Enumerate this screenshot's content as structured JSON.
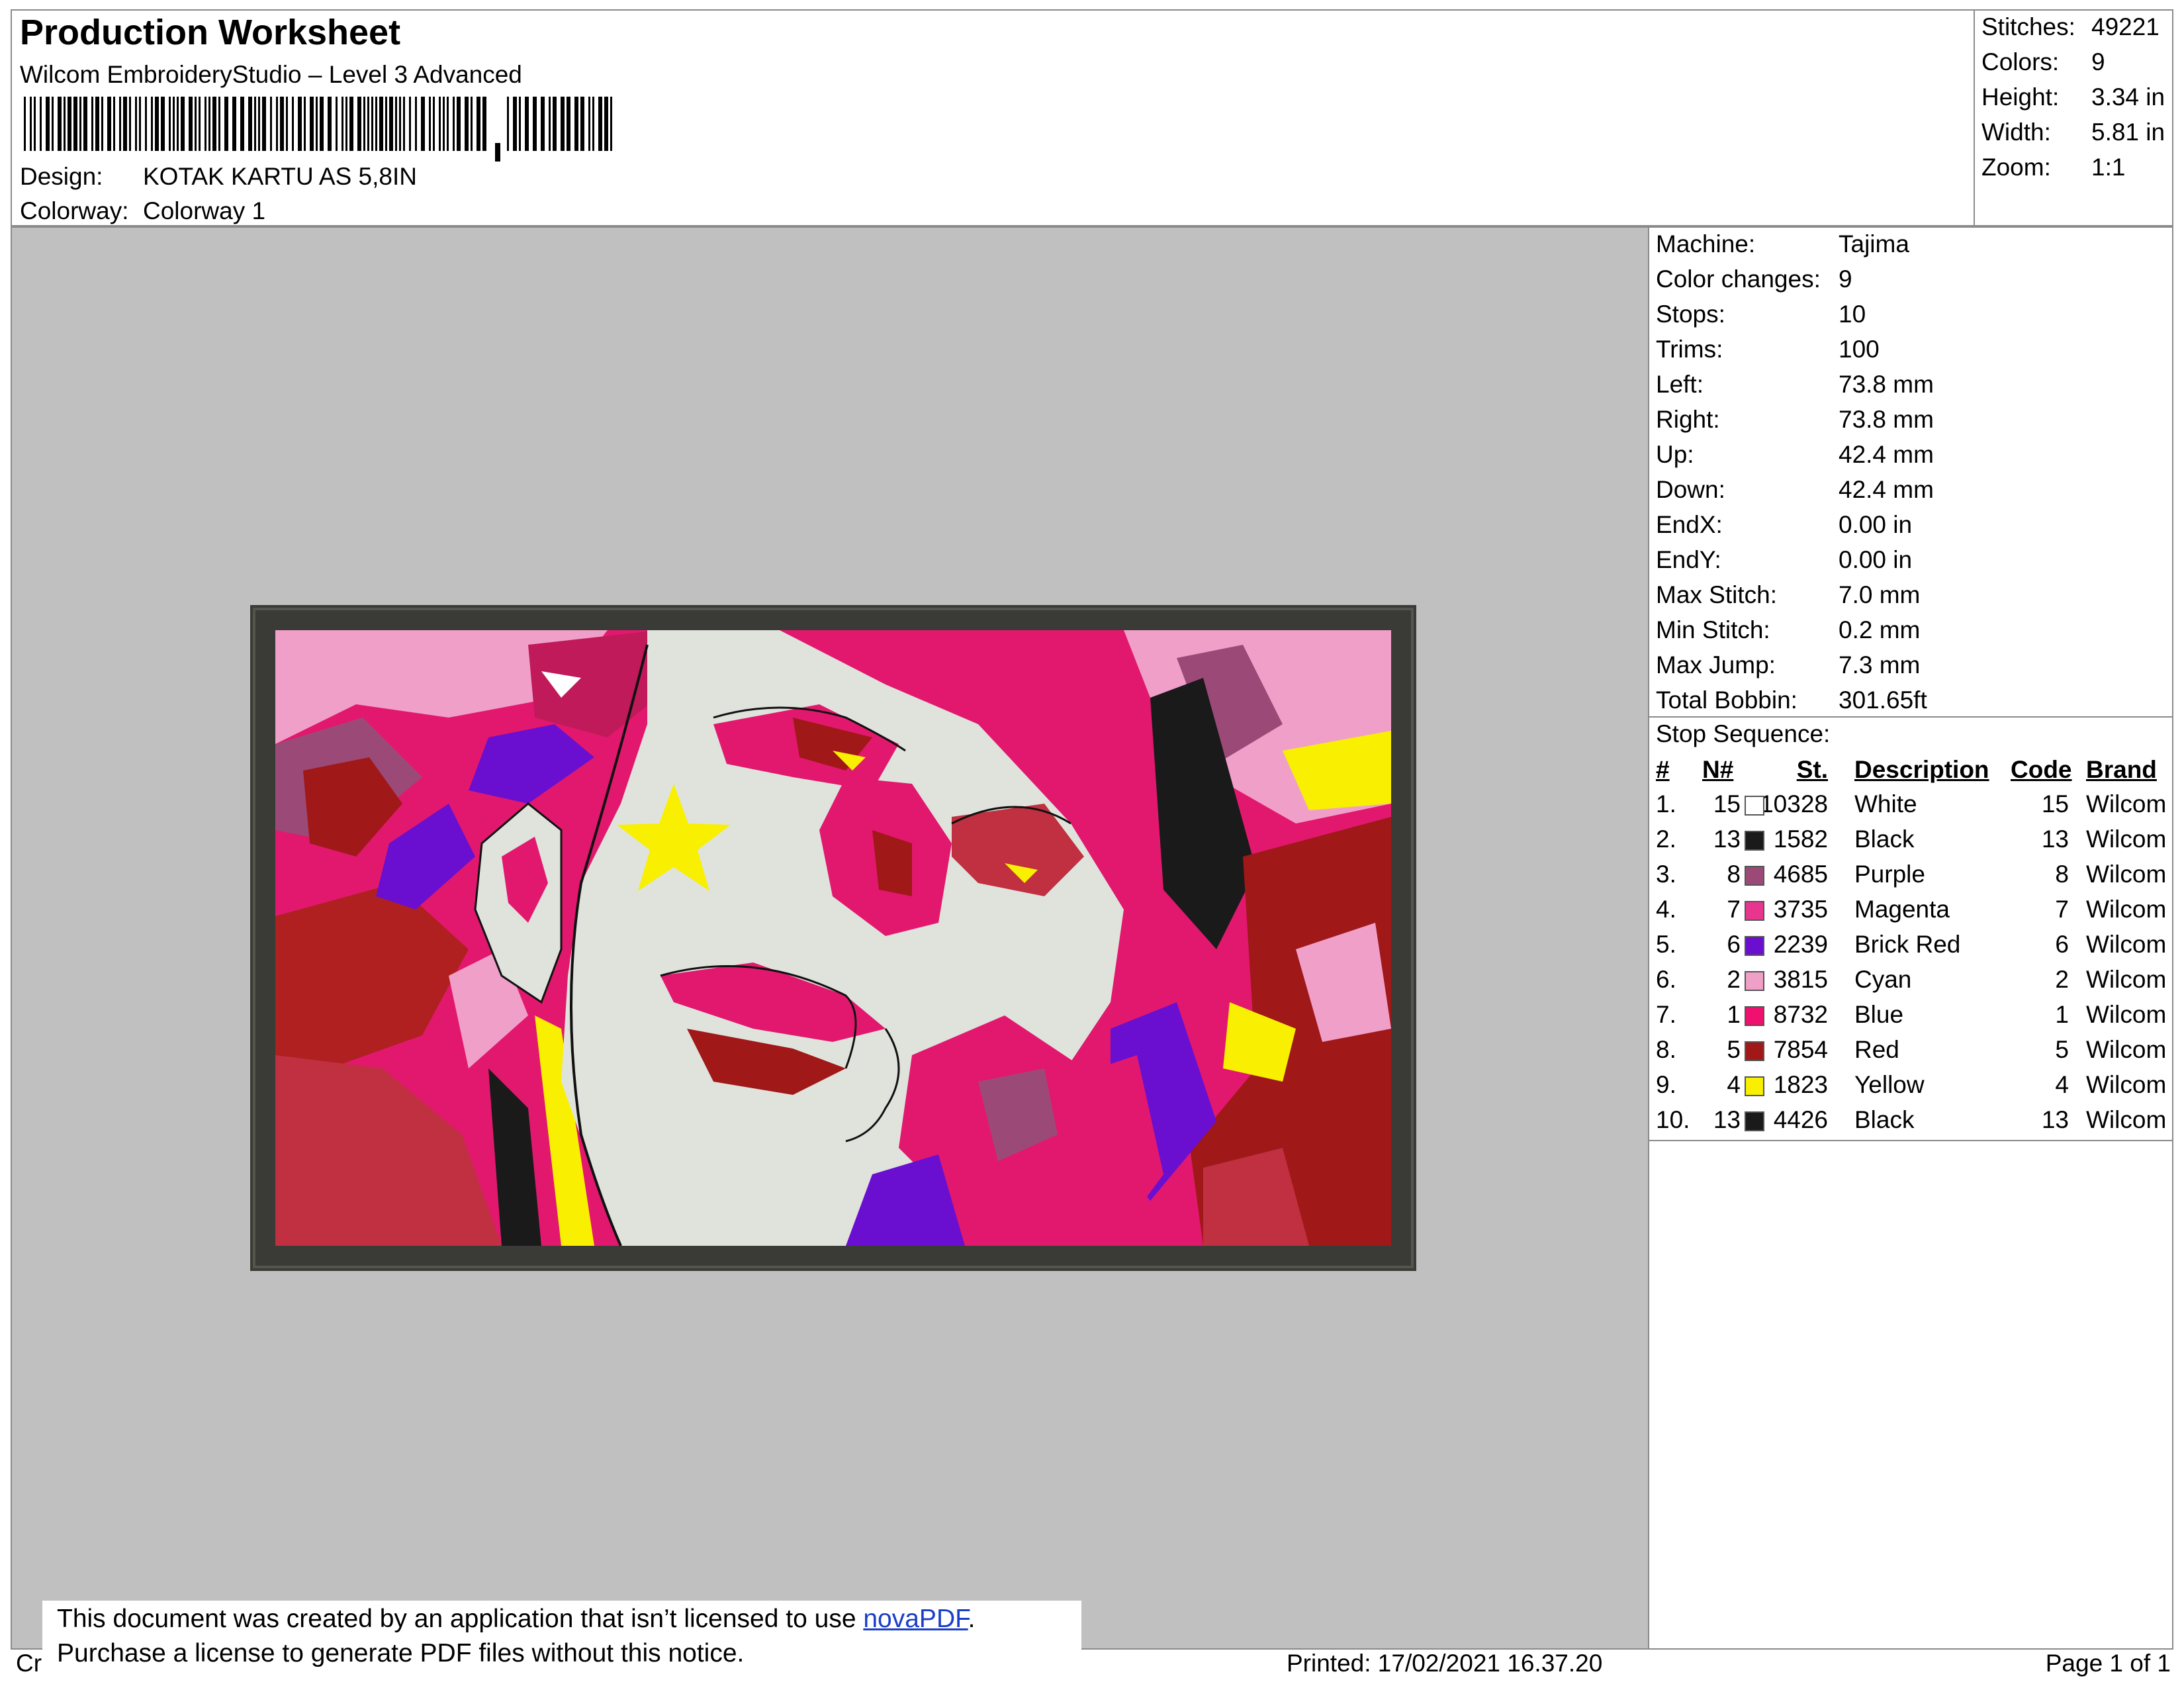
{
  "header": {
    "title": "Production Worksheet",
    "app_name": "Wilcom EmbroideryStudio – Level 3 Advanced",
    "design_label": "Design:",
    "design_value": "KOTAK KARTU AS 5,8IN",
    "colorway_label": "Colorway:",
    "colorway_value": "Colorway 1"
  },
  "stats": [
    {
      "label": "Stitches:",
      "value": "49221"
    },
    {
      "label": "Colors:",
      "value": "9"
    },
    {
      "label": "Height:",
      "value": "3.34 in"
    },
    {
      "label": "Width:",
      "value": "5.81 in"
    },
    {
      "label": "Zoom:",
      "value": "1:1"
    }
  ],
  "machine_info": [
    {
      "label": "Machine:",
      "value": "Tajima"
    },
    {
      "label": "Color changes:",
      "value": "9"
    },
    {
      "label": "Stops:",
      "value": "10"
    },
    {
      "label": "Trims:",
      "value": "100"
    },
    {
      "label": "Left:",
      "value": "73.8 mm"
    },
    {
      "label": "Right:",
      "value": "73.8 mm"
    },
    {
      "label": "Up:",
      "value": "42.4 mm"
    },
    {
      "label": "Down:",
      "value": "42.4 mm"
    },
    {
      "label": "EndX:",
      "value": "0.00 in"
    },
    {
      "label": "EndY:",
      "value": "0.00 in"
    },
    {
      "label": "Max Stitch:",
      "value": "7.0 mm"
    },
    {
      "label": "Min Stitch:",
      "value": "0.2 mm"
    },
    {
      "label": "Max Jump:",
      "value": "7.3 mm"
    },
    {
      "label": "Total Bobbin:",
      "value": "301.65ft"
    }
  ],
  "stop_sequence": {
    "title": "Stop Sequence:",
    "headers": {
      "num": "#",
      "n": "N#",
      "st": "St.",
      "description": "Description",
      "code": "Code",
      "brand": "Brand"
    },
    "rows": [
      {
        "num": "1.",
        "n": "15",
        "color": "#ffffff",
        "st": "10328",
        "description": "White",
        "code": "15",
        "brand": "Wilcom"
      },
      {
        "num": "2.",
        "n": "13",
        "color": "#1a1a1a",
        "st": "1582",
        "description": "Black",
        "code": "13",
        "brand": "Wilcom"
      },
      {
        "num": "3.",
        "n": "8",
        "color": "#9b4a78",
        "st": "4685",
        "description": "Purple",
        "code": "8",
        "brand": "Wilcom"
      },
      {
        "num": "4.",
        "n": "7",
        "color": "#e8368f",
        "st": "3735",
        "description": "Magenta",
        "code": "7",
        "brand": "Wilcom"
      },
      {
        "num": "5.",
        "n": "6",
        "color": "#6a0fd0",
        "st": "2239",
        "description": "Brick Red",
        "code": "6",
        "brand": "Wilcom"
      },
      {
        "num": "6.",
        "n": "2",
        "color": "#f0a0c8",
        "st": "3815",
        "description": "Cyan",
        "code": "2",
        "brand": "Wilcom"
      },
      {
        "num": "7.",
        "n": "1",
        "color": "#f01070",
        "st": "8732",
        "description": "Blue",
        "code": "1",
        "brand": "Wilcom"
      },
      {
        "num": "8.",
        "n": "5",
        "color": "#a01818",
        "st": "7854",
        "description": "Red",
        "code": "5",
        "brand": "Wilcom"
      },
      {
        "num": "9.",
        "n": "4",
        "color": "#f8f000",
        "st": "1823",
        "description": "Yellow",
        "code": "4",
        "brand": "Wilcom"
      },
      {
        "num": "10.",
        "n": "13",
        "color": "#1a1a1a",
        "st": "4426",
        "description": "Black",
        "code": "13",
        "brand": "Wilcom"
      }
    ]
  },
  "footer": {
    "left_text": "Cr",
    "printed": "Printed: 17/02/2021 16.37.20",
    "page": "Page 1 of 1"
  },
  "notice": {
    "line1_prefix": "This document was created by an application that isn’t licensed to use ",
    "line1_link": "novaPDF",
    "line1_suffix": ".",
    "line2": "Purchase a license to generate PDF files without this notice."
  },
  "preview": {
    "background": "#c0c0c0",
    "border_color": "#3a3a36"
  }
}
